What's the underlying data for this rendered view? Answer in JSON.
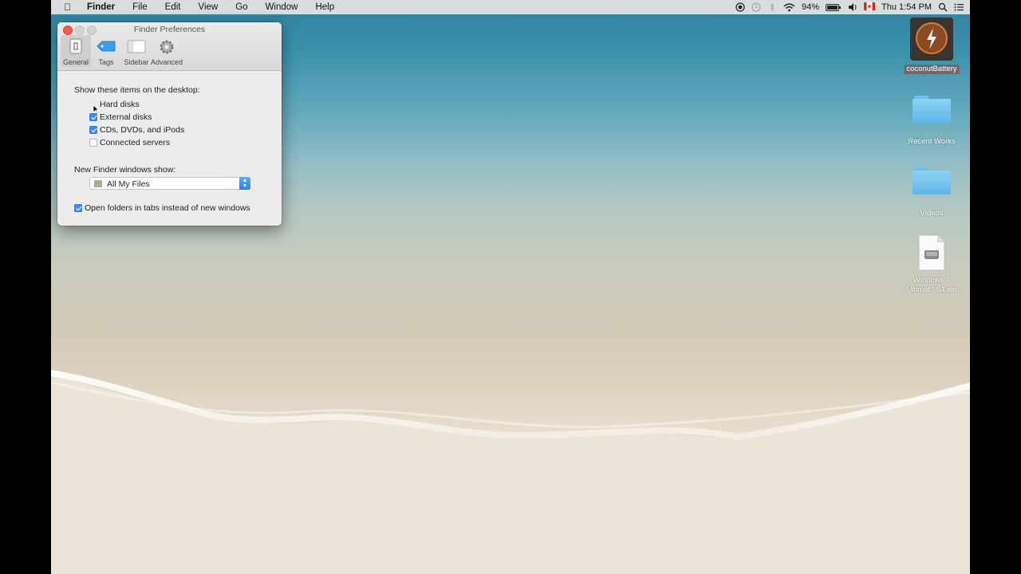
{
  "menubar": {
    "app_name": "Finder",
    "items": [
      "File",
      "Edit",
      "View",
      "Go",
      "Window",
      "Help"
    ],
    "battery_percent": "94%",
    "clock": "Thu 1:54 PM"
  },
  "window": {
    "title": "Finder Preferences",
    "tabs": [
      {
        "label": "General",
        "icon": "general-icon",
        "selected": true
      },
      {
        "label": "Tags",
        "icon": "tag-icon",
        "selected": false
      },
      {
        "label": "Sidebar",
        "icon": "sidebar-icon",
        "selected": false
      },
      {
        "label": "Advanced",
        "icon": "gear-icon",
        "selected": false
      }
    ],
    "desktop_section_label": "Show these items on the desktop:",
    "desktop_items": [
      {
        "label": "Hard disks",
        "checked": false
      },
      {
        "label": "External disks",
        "checked": true
      },
      {
        "label": "CDs, DVDs, and iPods",
        "checked": true
      },
      {
        "label": "Connected servers",
        "checked": false
      }
    ],
    "new_window_label": "New Finder windows show:",
    "new_window_value": "All My Files",
    "tabs_option": {
      "label": "Open folders in tabs instead of new windows",
      "checked": true
    }
  },
  "desktop_icons": [
    {
      "label": "coconutBattery",
      "kind": "app-icon"
    },
    {
      "label": "Recent Works",
      "kind": "folder-icon"
    },
    {
      "label": "Videos",
      "kind": "folder-icon"
    },
    {
      "label": "Windows 7 Ultimat...64.iso",
      "kind": "disk-image-icon"
    }
  ],
  "colors": {
    "accent": "#3b8ff4",
    "close_button": "#f45c50",
    "folder": "#6fc0ee"
  }
}
